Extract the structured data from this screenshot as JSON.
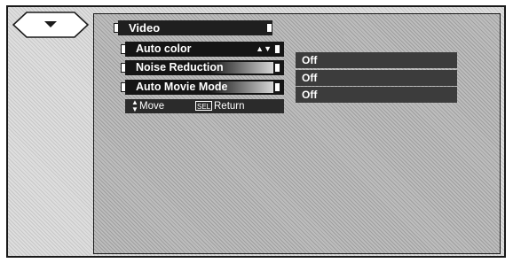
{
  "menu": {
    "title": "Video",
    "items": [
      {
        "label": "Auto color",
        "value": "Off",
        "selected": true
      },
      {
        "label": "Noise Reduction",
        "value": "Off",
        "selected": false
      },
      {
        "label": "Auto Movie Mode",
        "value": "Off",
        "selected": false
      }
    ]
  },
  "help": {
    "move_label": "Move",
    "sel_key": "SEL",
    "return_label": "Return"
  },
  "icons": {
    "nav": "down-triangle-icon",
    "move": "up-down-arrows-icon"
  }
}
